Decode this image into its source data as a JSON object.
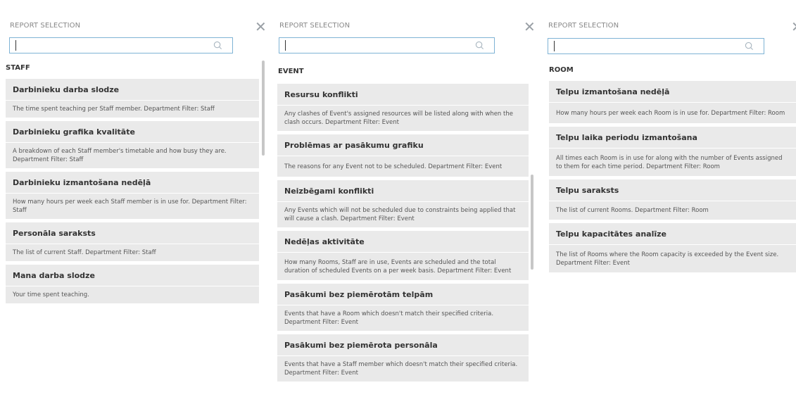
{
  "panels": [
    {
      "header": "REPORT SELECTION",
      "search_value": "",
      "category": "STAFF",
      "items": [
        {
          "title": "Darbinieku darba slodze",
          "desc": "The time spent teaching per Staff member. Department Filter: Staff"
        },
        {
          "title": "Darbinieku grafika kvalitāte",
          "desc": "A breakdown of each Staff member's timetable and how busy they are. Department Filter: Staff"
        },
        {
          "title": "Darbinieku izmantošana nedēļā",
          "desc": "How many hours per week each Staff member is in use for. Department Filter: Staff"
        },
        {
          "title": "Personāla saraksts",
          "desc": "The list of current Staff. Department Filter: Staff"
        },
        {
          "title": "Mana darba slodze",
          "desc": "Your time spent teaching."
        }
      ]
    },
    {
      "header": "REPORT SELECTION",
      "search_value": "",
      "category": "EVENT",
      "items": [
        {
          "title": "Resursu konflikti",
          "desc": "Any clashes of Event's assigned resources will be listed along with when the clash occurs. Department Filter: Event"
        },
        {
          "title": "Problēmas ar pasākumu grafiku",
          "desc": "The reasons for any Event not to be scheduled. Department Filter: Event"
        },
        {
          "title": "Neizbēgami konflikti",
          "desc": "Any Events which will not be scheduled due to constraints being applied that will cause a clash. Department Filter: Event"
        },
        {
          "title": "Nedēļas aktivitāte",
          "desc": "How many Rooms, Staff are in use, Events are scheduled and the total duration of scheduled Events on a per week basis. Department Filter: Event"
        },
        {
          "title": "Pasākumi bez piemērotām telpām",
          "desc": "Events that have a Room which doesn't match their specified criteria. Department Filter: Event"
        },
        {
          "title": "Pasākumi bez piemērota personāla",
          "desc": "Events that have a Staff member which doesn't match their specified criteria. Department Filter: Event"
        }
      ]
    },
    {
      "header": "REPORT SELECTION",
      "search_value": "",
      "category": "ROOM",
      "items": [
        {
          "title": "Telpu izmantošana nedēļā",
          "desc": "How many hours per week each Room is in use for. Department Filter: Room"
        },
        {
          "title": "Telpu laika periodu izmantošana",
          "desc": "All times each Room is in use for along with the number of Events assigned to them for each time period. Department Filter: Room"
        },
        {
          "title": "Telpu saraksts",
          "desc": "The list of current Rooms. Department Filter: Room"
        },
        {
          "title": "Telpu kapacitātes analīze",
          "desc": "The list of Rooms where the Room capacity is exceeded by the Event size. Department Filter: Event"
        }
      ]
    }
  ],
  "icons": {
    "close": "close-icon",
    "search": "search-icon"
  },
  "colors": {
    "search_border": "#7fb3d5",
    "item_bg": "#eaeaea",
    "header_text": "#888888"
  }
}
